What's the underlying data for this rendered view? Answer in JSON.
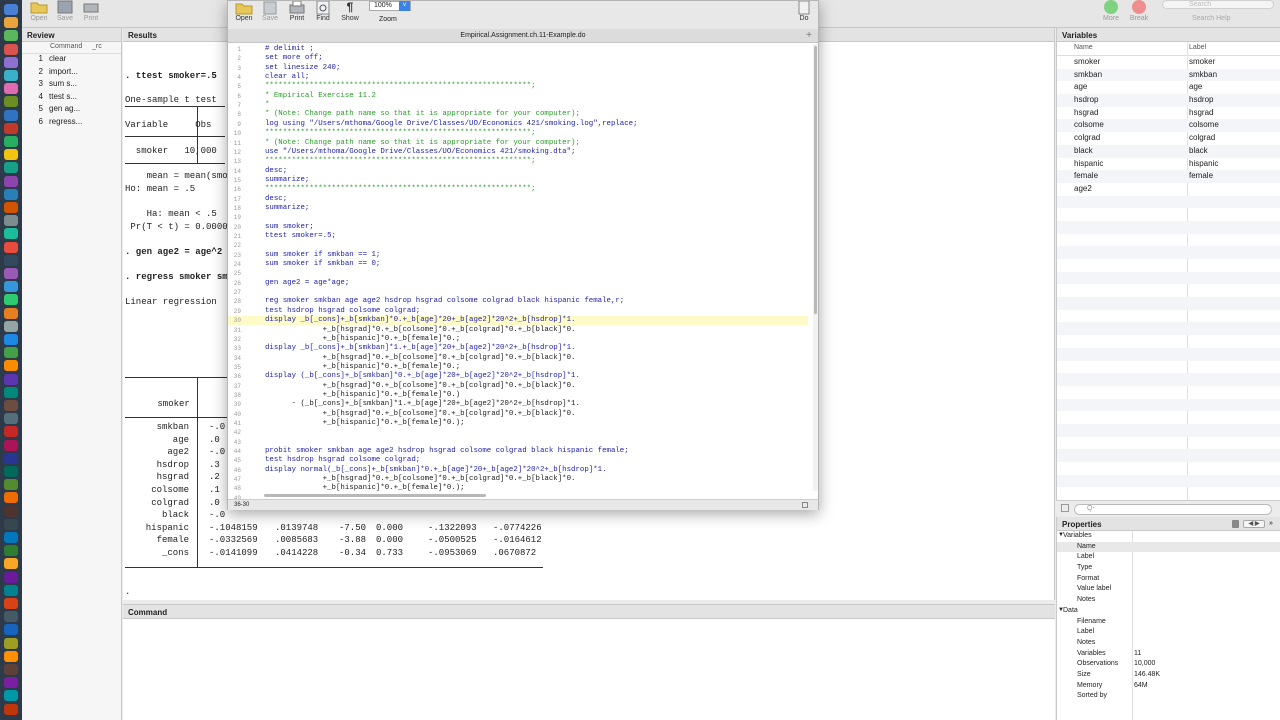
{
  "stata_toolbar": {
    "open": "Open",
    "save": "Save",
    "print": "Print",
    "more": "More",
    "break": "Break",
    "search_placeholder": "Search",
    "search_help": "Search Help"
  },
  "review": {
    "title": "Review",
    "col_command": "Command",
    "col_rc": "_rc",
    "items": [
      {
        "n": "1",
        "cmd": "clear"
      },
      {
        "n": "2",
        "cmd": "import..."
      },
      {
        "n": "3",
        "cmd": "sum s..."
      },
      {
        "n": "4",
        "cmd": "ttest s..."
      },
      {
        "n": "5",
        "cmd": "gen ag..."
      },
      {
        "n": "6",
        "cmd": "regress..."
      }
    ]
  },
  "results": {
    "title": "Results",
    "lines": [
      {
        "t": ". ttest smoker=.5",
        "bold": true
      },
      {
        "t": "One-sample t test",
        "bold": false
      },
      {
        "t": "Variable     Obs",
        "bold": false
      },
      {
        "t": "  smoker   10,000",
        "bold": false
      },
      {
        "t": "    mean = mean(smo",
        "bold": false
      },
      {
        "t": "Ho: mean = .5",
        "bold": false
      },
      {
        "t": "    Ha: mean < .5",
        "bold": false
      },
      {
        "t": " Pr(T < t) = 0.0000",
        "bold": false
      },
      {
        "t": ". gen age2 = age^2",
        "bold": true
      },
      {
        "t": ". regress smoker sm",
        "bold": true
      },
      {
        "t": "Linear regression",
        "bold": false
      },
      {
        "t": "      smoker",
        "bold": false
      }
    ],
    "coef_rows": [
      {
        "var": "smkban",
        "c": "-.0"
      },
      {
        "var": "age",
        "c": ".0"
      },
      {
        "var": "age2",
        "c": "-.0"
      },
      {
        "var": "hsdrop",
        "c": ".3"
      },
      {
        "var": "hsgrad",
        "c": ".2"
      },
      {
        "var": "colsome",
        "c": ".1"
      },
      {
        "var": "colgrad",
        "c": ".0"
      },
      {
        "var": "black",
        "c": "-.0"
      },
      {
        "var": "hispanic",
        "c": "-.1048159",
        "se": ".0139748",
        "t": "-7.50",
        "p": "0.000",
        "lo": "-.1322093",
        "hi": "-.0774226"
      },
      {
        "var": "female",
        "c": "-.0332569",
        "se": ".0085683",
        "t": "-3.88",
        "p": "0.000",
        "lo": "-.0500525",
        "hi": "-.0164612"
      },
      {
        "var": "_cons",
        "c": "-.0141099",
        "se": ".0414228",
        "t": "-0.34",
        "p": "0.733",
        "lo": "-.0953069",
        "hi": ".0670872"
      }
    ],
    "prompt": "."
  },
  "command": {
    "title": "Command",
    "value": ""
  },
  "variables": {
    "title": "Variables",
    "col_name": "Name",
    "col_label": "Label",
    "items": [
      {
        "name": "smoker",
        "label": "smoker"
      },
      {
        "name": "smkban",
        "label": "smkban"
      },
      {
        "name": "age",
        "label": "age"
      },
      {
        "name": "hsdrop",
        "label": "hsdrop"
      },
      {
        "name": "hsgrad",
        "label": "hsgrad"
      },
      {
        "name": "colsome",
        "label": "colsome"
      },
      {
        "name": "colgrad",
        "label": "colgrad"
      },
      {
        "name": "black",
        "label": "black"
      },
      {
        "name": "hispanic",
        "label": "hispanic"
      },
      {
        "name": "female",
        "label": "female"
      },
      {
        "name": "age2",
        "label": ""
      }
    ],
    "filter_placeholder": "Q-"
  },
  "properties": {
    "title": "Properties",
    "variables_group": "Variables",
    "var_rows": [
      {
        "k": "Name",
        "v": ""
      },
      {
        "k": "Label",
        "v": ""
      },
      {
        "k": "Type",
        "v": ""
      },
      {
        "k": "Format",
        "v": ""
      },
      {
        "k": "Value label",
        "v": ""
      },
      {
        "k": "Notes",
        "v": ""
      }
    ],
    "data_group": "Data",
    "data_rows": [
      {
        "k": "Filename",
        "v": ""
      },
      {
        "k": "Label",
        "v": ""
      },
      {
        "k": "Notes",
        "v": ""
      },
      {
        "k": "Variables",
        "v": "11"
      },
      {
        "k": "Observations",
        "v": "10,000"
      },
      {
        "k": "Size",
        "v": "146.48K"
      },
      {
        "k": "Memory",
        "v": "64M"
      },
      {
        "k": "Sorted by",
        "v": ""
      }
    ]
  },
  "editor": {
    "toolbar": {
      "open": "Open",
      "save": "Save",
      "print": "Print",
      "find": "Find",
      "show": "Show",
      "zoom_label": "Zoom",
      "zoom_value": "100%",
      "do": "Do"
    },
    "filename": "Empirical.Assignment.ch.11-Example.do",
    "status": "36-30",
    "highlight_line": 30,
    "lines": [
      "# delimit ;",
      "set more off;",
      "set linesize 240;",
      "clear all;",
      "************************************************************;",
      "* Empirical Exercise 11.2",
      "*",
      "* (Note: Change path name so that it is appropriate for your computer);",
      "log using \"/Users/mthoma/Google Drive/Classes/UO/Economics 421/smoking.log\",replace;",
      "************************************************************;",
      "* (Note: Change path name so that it is appropriate for your computer);",
      "use \"/Users/mthoma/Google Drive/Classes/UO/Economics 421/smoking.dta\";",
      "************************************************************;",
      "desc;",
      "summarize;",
      "************************************************************;",
      "desc;",
      "summarize;",
      "",
      "sum smoker;",
      "ttest smoker=.5;",
      "",
      "sum smoker if smkban == 1;",
      "sum smoker if smkban == 0;",
      "",
      "gen age2 = age*age;",
      "",
      "reg smoker smkban age age2 hsdrop hsgrad colsome colgrad black hispanic female,r;",
      "test hsdrop hsgrad colsome colgrad;",
      "display _b[_cons]+_b[smkban]*0.+_b[age]*20+_b[age2]*20^2+_b[hsdrop]*1.",
      "             +_b[hsgrad]*0.+_b[colsome]*0.+_b[colgrad]*0.+_b[black]*0.",
      "             +_b[hispanic]*0.+_b[female]*0.;",
      "display _b[_cons]+_b[smkban]*1.+_b[age]*20+_b[age2]*20^2+_b[hsdrop]*1.",
      "             +_b[hsgrad]*0.+_b[colsome]*0.+_b[colgrad]*0.+_b[black]*0.",
      "             +_b[hispanic]*0.+_b[female]*0.;",
      "display (_b[_cons]+_b[smkban]*0.+_b[age]*20+_b[age2]*20^2+_b[hsdrop]*1.",
      "             +_b[hsgrad]*0.+_b[colsome]*0.+_b[colgrad]*0.+_b[black]*0.",
      "             +_b[hispanic]*0.+_b[female]*0.)",
      "      - (_b[_cons]+_b[smkban]*1.+_b[age]*20+_b[age2]*20^2+_b[hsdrop]*1.",
      "             +_b[hsgrad]*0.+_b[colsome]*0.+_b[colgrad]*0.+_b[black]*0.",
      "             +_b[hispanic]*0.+_b[female]*0.);",
      "",
      "",
      "probit smoker smkban age age2 hsdrop hsgrad colsome colgrad black hispanic female;",
      "test hsdrop hsgrad colsome colgrad;",
      "display normal(_b[_cons]+_b[smkban]*0.+_b[age]*20+_b[age2]*20^2+_b[hsdrop]*1.",
      "             +_b[hsgrad]*0.+_b[colsome]*0.+_b[colgrad]*0.+_b[black]*0.",
      "             +_b[hispanic]*0.+_b[female]*0.);",
      ""
    ]
  },
  "colors": {
    "dock": "#2d3a4a",
    "highlight": "#fffbc8",
    "keyword": "#1e1ea8",
    "comment": "#2a9b2a",
    "string": "#7a1e9e"
  }
}
